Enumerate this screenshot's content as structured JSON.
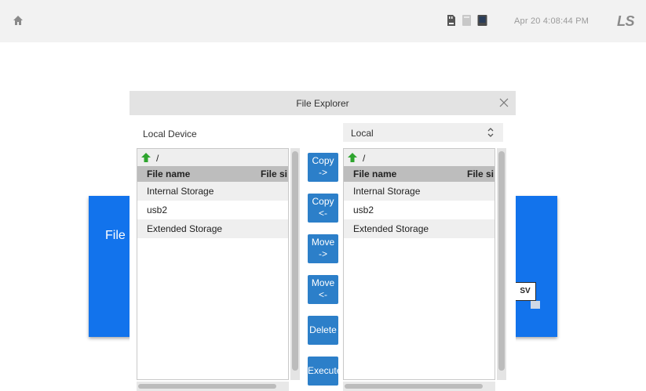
{
  "status_bar": {
    "home_icon": "home-icon",
    "status_icons": [
      "sd-card-icon",
      "storage-icon",
      "monitor-icon"
    ],
    "datetime": "Apr 20 4:08:44 PM",
    "brand": "LS"
  },
  "background": {
    "left_card_text": "File",
    "right_badge_text": "SV",
    "accent_color": "#1273ec"
  },
  "dialog": {
    "title": "File Explorer",
    "local_label": "Local Device",
    "remote_select": {
      "value": "Local"
    },
    "left_pane": {
      "path": "/",
      "columns": [
        "File name",
        "File si"
      ],
      "rows": [
        "Internal Storage",
        "usb2",
        "Extended Storage"
      ]
    },
    "right_pane": {
      "path": "/",
      "columns": [
        "File name",
        "File si"
      ],
      "rows": [
        "Internal Storage",
        "usb2",
        "Extended Storage"
      ]
    },
    "actions": {
      "copy_right": [
        "Copy",
        "->"
      ],
      "copy_left": [
        "Copy",
        "<-"
      ],
      "move_right": [
        "Move",
        "->"
      ],
      "move_left": [
        "Move",
        "<-"
      ],
      "delete": "Delete",
      "execute": "Execute"
    },
    "button_color": "#2c7fc9"
  }
}
